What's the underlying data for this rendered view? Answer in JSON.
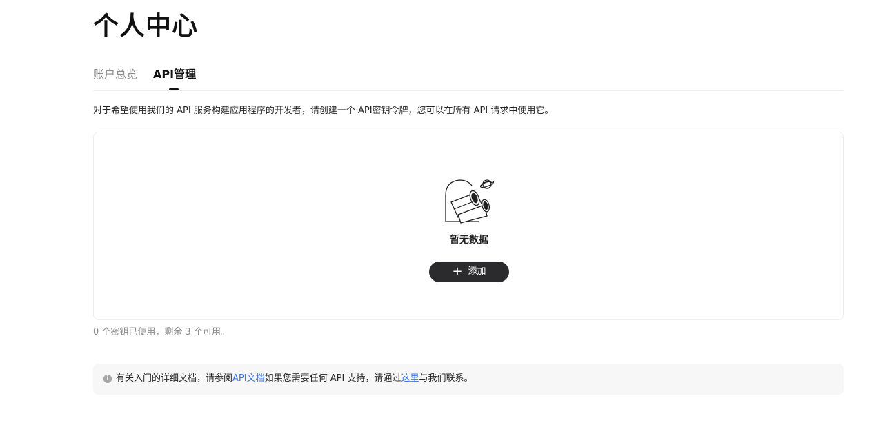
{
  "page_title": "个人中心",
  "tabs": [
    {
      "label": "账户总览",
      "active": false
    },
    {
      "label": "API管理",
      "active": true
    }
  ],
  "description": "对于希望使用我们的 API 服务构建应用程序的开发者，请创建一个 API密钥令牌，您可以在所有 API 请求中使用它。",
  "empty_state": {
    "icon": "binoculars-planet-illustration",
    "text": "暂无数据",
    "add_button_label": "添加",
    "add_button_icon": "plus-icon"
  },
  "usage_text": "0 个密钥已使用，剩余 3 个可用。",
  "info": {
    "icon": "info-icon",
    "text_before": "有关入门的详细文档，请参阅 ",
    "docs_link": "API文档",
    "text_middle": " 如果您需要任何 API 支持，请通过",
    "contact_link": "这里",
    "text_after": "与我们联系。"
  },
  "colors": {
    "accent": "#2b2b2e",
    "link": "#3874e8",
    "muted": "#8c8c8c",
    "info_bg": "#f7f7f8"
  }
}
